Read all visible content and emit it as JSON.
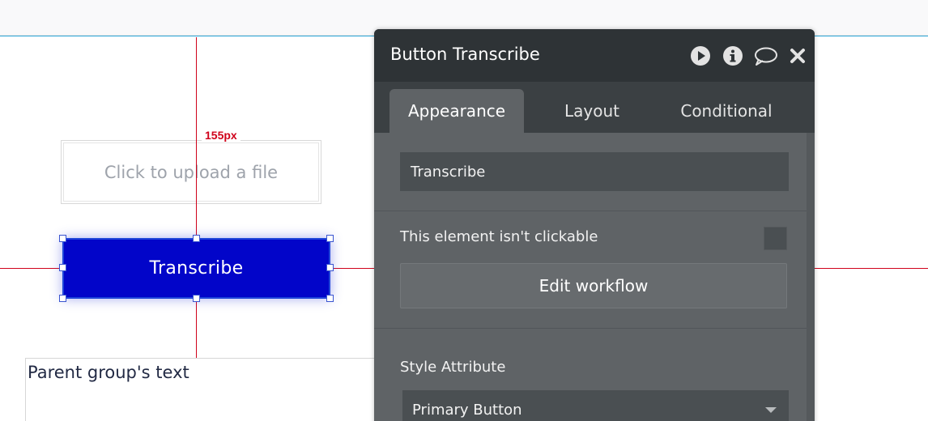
{
  "canvas": {
    "measurement_label": "155px",
    "upload_placeholder": "Click to upload a file",
    "transcribe_button_label": "Transcribe",
    "parent_group_text": "Parent group's text"
  },
  "property_editor": {
    "title": "Button Transcribe",
    "header_icons": [
      "play-icon",
      "info-icon",
      "comment-icon",
      "close-icon"
    ],
    "tabs": [
      {
        "label": "Appearance",
        "active": true
      },
      {
        "label": "Layout",
        "active": false
      },
      {
        "label": "Conditional",
        "active": false
      }
    ],
    "button_text_value": "Transcribe",
    "not_clickable_label": "This element isn't clickable",
    "edit_workflow_label": "Edit workflow",
    "style_attribute_label": "Style Attribute",
    "style_attribute_value": "Primary Button"
  },
  "colors": {
    "button_primary": "#0205c9",
    "guide_line": "#d0021b",
    "panel_background": "#5f6366",
    "panel_header": "#2e3336"
  }
}
